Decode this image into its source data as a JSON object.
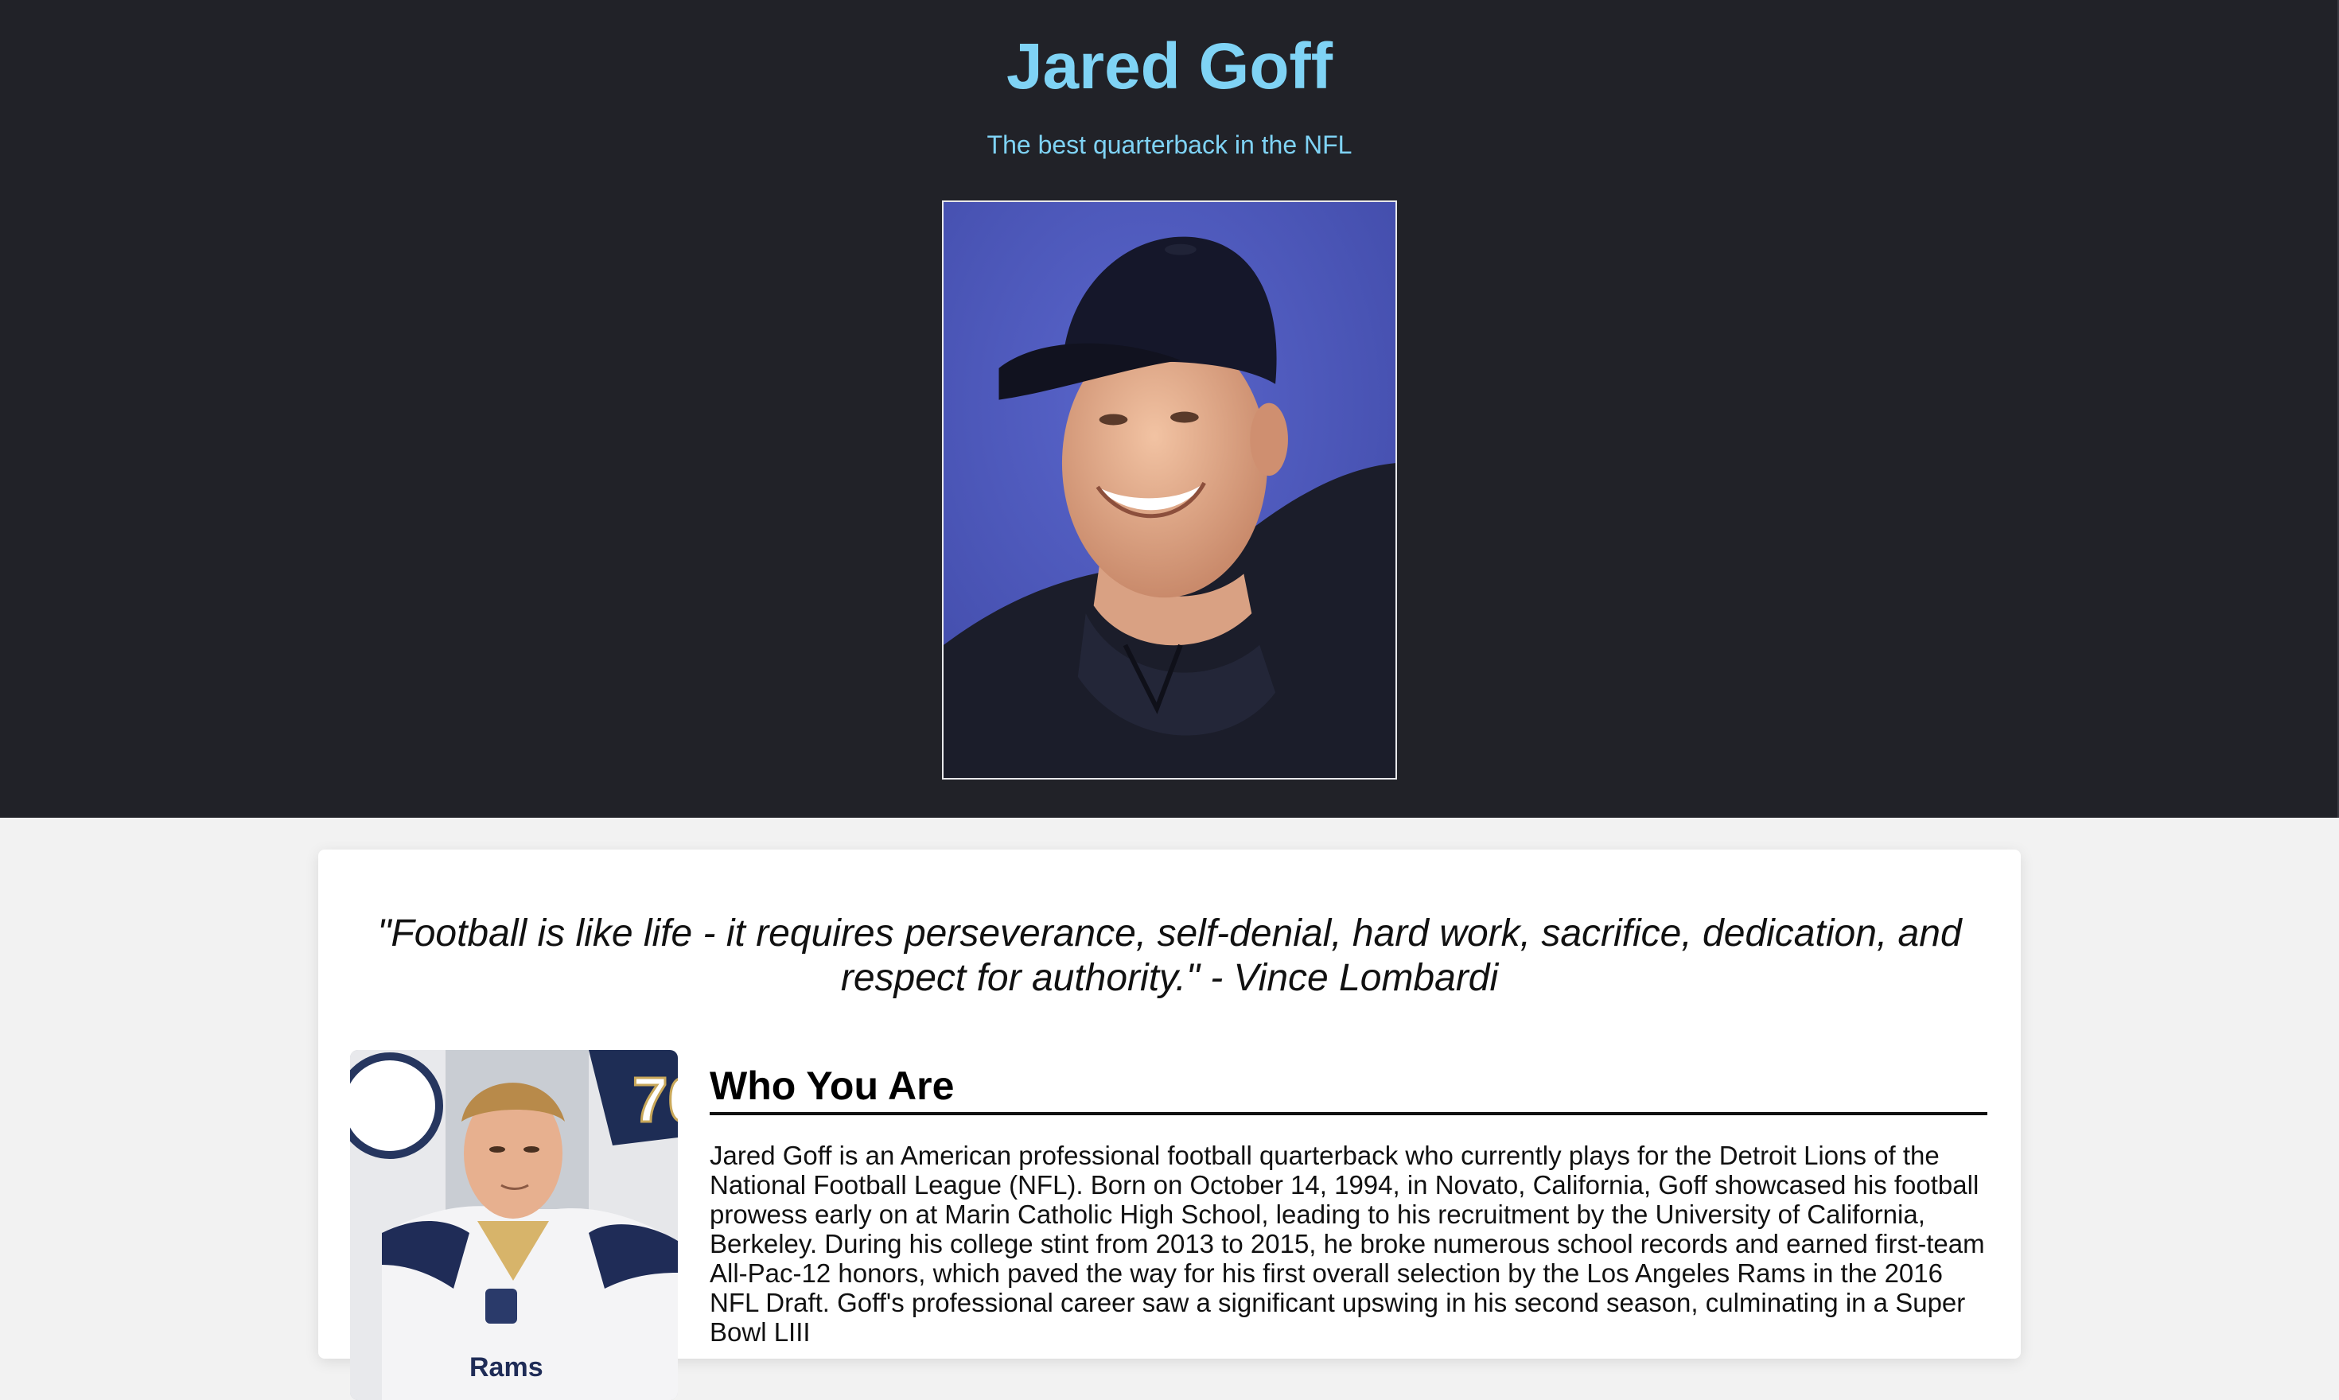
{
  "header": {
    "title": "Jared Goff",
    "subtitle": "The best quarterback in the NFL"
  },
  "main": {
    "quote": "\"Football is like life - it requires perseverance, self-denial, hard work, sacrifice, dedication, and respect for authority.\" - Vince Lombardi",
    "section_title": "Who You Are",
    "bio": "Jared Goff is an American professional football quarterback who currently plays for the Detroit Lions of the National Football League (NFL). Born on October 14, 1994, in Novato, California, Goff showcased his football prowess early on at Marin Catholic High School, leading to his recruitment by the University of California, Berkeley. During his college stint from 2013 to 2015, he broke numerous school records and earned first-team All-Pac-12 honors, which paved the way for his first overall selection by the Los Angeles Rams in the 2016 NFL Draft. Goff's professional career saw a significant upswing in his second season, culminating in a Super Bowl LIII"
  },
  "colors": {
    "header_bg": "#212228",
    "accent": "#7fd3f5",
    "page_bg": "#f2f2f2",
    "card_bg": "#ffffff"
  }
}
